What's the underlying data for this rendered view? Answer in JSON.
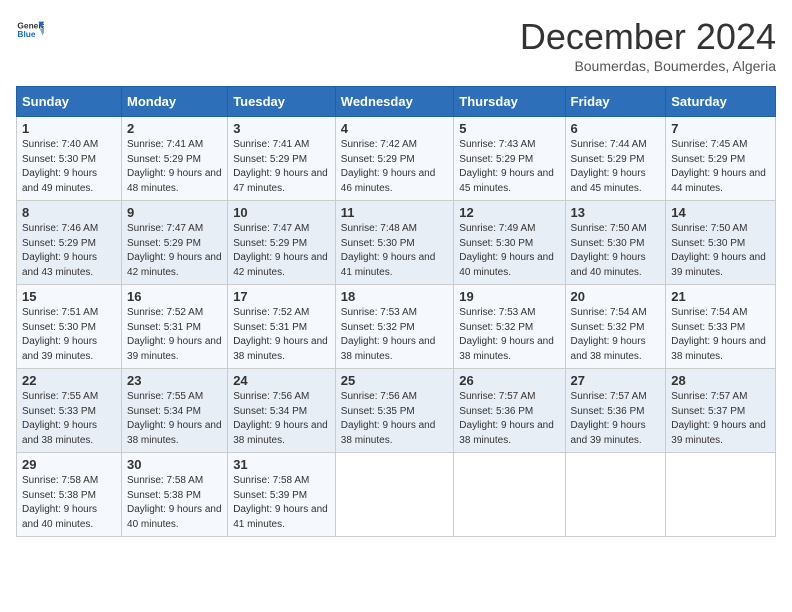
{
  "header": {
    "logo_general": "General",
    "logo_blue": "Blue",
    "title": "December 2024",
    "subtitle": "Boumerdas, Boumerdes, Algeria"
  },
  "weekdays": [
    "Sunday",
    "Monday",
    "Tuesday",
    "Wednesday",
    "Thursday",
    "Friday",
    "Saturday"
  ],
  "weeks": [
    [
      {
        "day": "1",
        "sunrise": "7:40 AM",
        "sunset": "5:30 PM",
        "daylight": "9 hours and 49 minutes."
      },
      {
        "day": "2",
        "sunrise": "7:41 AM",
        "sunset": "5:29 PM",
        "daylight": "9 hours and 48 minutes."
      },
      {
        "day": "3",
        "sunrise": "7:41 AM",
        "sunset": "5:29 PM",
        "daylight": "9 hours and 47 minutes."
      },
      {
        "day": "4",
        "sunrise": "7:42 AM",
        "sunset": "5:29 PM",
        "daylight": "9 hours and 46 minutes."
      },
      {
        "day": "5",
        "sunrise": "7:43 AM",
        "sunset": "5:29 PM",
        "daylight": "9 hours and 45 minutes."
      },
      {
        "day": "6",
        "sunrise": "7:44 AM",
        "sunset": "5:29 PM",
        "daylight": "9 hours and 45 minutes."
      },
      {
        "day": "7",
        "sunrise": "7:45 AM",
        "sunset": "5:29 PM",
        "daylight": "9 hours and 44 minutes."
      }
    ],
    [
      {
        "day": "8",
        "sunrise": "7:46 AM",
        "sunset": "5:29 PM",
        "daylight": "9 hours and 43 minutes."
      },
      {
        "day": "9",
        "sunrise": "7:47 AM",
        "sunset": "5:29 PM",
        "daylight": "9 hours and 42 minutes."
      },
      {
        "day": "10",
        "sunrise": "7:47 AM",
        "sunset": "5:29 PM",
        "daylight": "9 hours and 42 minutes."
      },
      {
        "day": "11",
        "sunrise": "7:48 AM",
        "sunset": "5:30 PM",
        "daylight": "9 hours and 41 minutes."
      },
      {
        "day": "12",
        "sunrise": "7:49 AM",
        "sunset": "5:30 PM",
        "daylight": "9 hours and 40 minutes."
      },
      {
        "day": "13",
        "sunrise": "7:50 AM",
        "sunset": "5:30 PM",
        "daylight": "9 hours and 40 minutes."
      },
      {
        "day": "14",
        "sunrise": "7:50 AM",
        "sunset": "5:30 PM",
        "daylight": "9 hours and 39 minutes."
      }
    ],
    [
      {
        "day": "15",
        "sunrise": "7:51 AM",
        "sunset": "5:30 PM",
        "daylight": "9 hours and 39 minutes."
      },
      {
        "day": "16",
        "sunrise": "7:52 AM",
        "sunset": "5:31 PM",
        "daylight": "9 hours and 39 minutes."
      },
      {
        "day": "17",
        "sunrise": "7:52 AM",
        "sunset": "5:31 PM",
        "daylight": "9 hours and 38 minutes."
      },
      {
        "day": "18",
        "sunrise": "7:53 AM",
        "sunset": "5:32 PM",
        "daylight": "9 hours and 38 minutes."
      },
      {
        "day": "19",
        "sunrise": "7:53 AM",
        "sunset": "5:32 PM",
        "daylight": "9 hours and 38 minutes."
      },
      {
        "day": "20",
        "sunrise": "7:54 AM",
        "sunset": "5:32 PM",
        "daylight": "9 hours and 38 minutes."
      },
      {
        "day": "21",
        "sunrise": "7:54 AM",
        "sunset": "5:33 PM",
        "daylight": "9 hours and 38 minutes."
      }
    ],
    [
      {
        "day": "22",
        "sunrise": "7:55 AM",
        "sunset": "5:33 PM",
        "daylight": "9 hours and 38 minutes."
      },
      {
        "day": "23",
        "sunrise": "7:55 AM",
        "sunset": "5:34 PM",
        "daylight": "9 hours and 38 minutes."
      },
      {
        "day": "24",
        "sunrise": "7:56 AM",
        "sunset": "5:34 PM",
        "daylight": "9 hours and 38 minutes."
      },
      {
        "day": "25",
        "sunrise": "7:56 AM",
        "sunset": "5:35 PM",
        "daylight": "9 hours and 38 minutes."
      },
      {
        "day": "26",
        "sunrise": "7:57 AM",
        "sunset": "5:36 PM",
        "daylight": "9 hours and 38 minutes."
      },
      {
        "day": "27",
        "sunrise": "7:57 AM",
        "sunset": "5:36 PM",
        "daylight": "9 hours and 39 minutes."
      },
      {
        "day": "28",
        "sunrise": "7:57 AM",
        "sunset": "5:37 PM",
        "daylight": "9 hours and 39 minutes."
      }
    ],
    [
      {
        "day": "29",
        "sunrise": "7:58 AM",
        "sunset": "5:38 PM",
        "daylight": "9 hours and 40 minutes."
      },
      {
        "day": "30",
        "sunrise": "7:58 AM",
        "sunset": "5:38 PM",
        "daylight": "9 hours and 40 minutes."
      },
      {
        "day": "31",
        "sunrise": "7:58 AM",
        "sunset": "5:39 PM",
        "daylight": "9 hours and 41 minutes."
      },
      null,
      null,
      null,
      null
    ]
  ]
}
